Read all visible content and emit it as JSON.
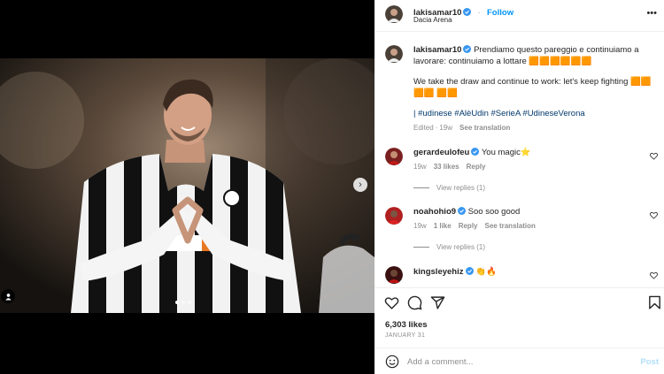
{
  "post": {
    "author": "lakisamar10",
    "follow_label": "Follow",
    "location": "Dacia Arena",
    "caption_it": "Prendiamo questo pareggio e continuiamo a lavorare: continuiamo a lottare 🟧🟧🟧🟧🟧🟧",
    "caption_en": "We take the draw and continue to work: let's keep fighting 🟧🟧🟧🟧 🟧🟧",
    "hashtags_prefix": "| ",
    "hashtags": "#udinese #AlèUdin #SerieA #UdineseVerona",
    "edited_label": "Edited",
    "edited_time": "19w",
    "see_translation": "See translation",
    "separator": "·"
  },
  "comments": [
    {
      "username": "gerardeulofeu",
      "text": "You magic⭐",
      "time": "19w",
      "likes": "33 likes",
      "reply": "Reply",
      "see_translation": "",
      "view_replies": "View replies (1)"
    },
    {
      "username": "noahohio9",
      "text": "Soo soo good",
      "time": "19w",
      "likes": "1 like",
      "reply": "Reply",
      "see_translation": "See translation",
      "view_replies": "View replies (1)"
    },
    {
      "username": "kingsleyehiz",
      "text": "👏🔥",
      "time": "",
      "likes": "",
      "reply": "",
      "see_translation": "",
      "view_replies": ""
    }
  ],
  "actions": {
    "likes": "6,303 likes",
    "date": "JANUARY 31"
  },
  "composer": {
    "placeholder": "Add a comment...",
    "post_label": "Post"
  },
  "media": {
    "carousel_total": 3,
    "carousel_active": 1,
    "next_arrow": "›"
  },
  "colors": {
    "link_blue": "#0095f6",
    "hashtag": "#00376b",
    "muted": "#8e8e8e",
    "verified": "#3897f0"
  }
}
